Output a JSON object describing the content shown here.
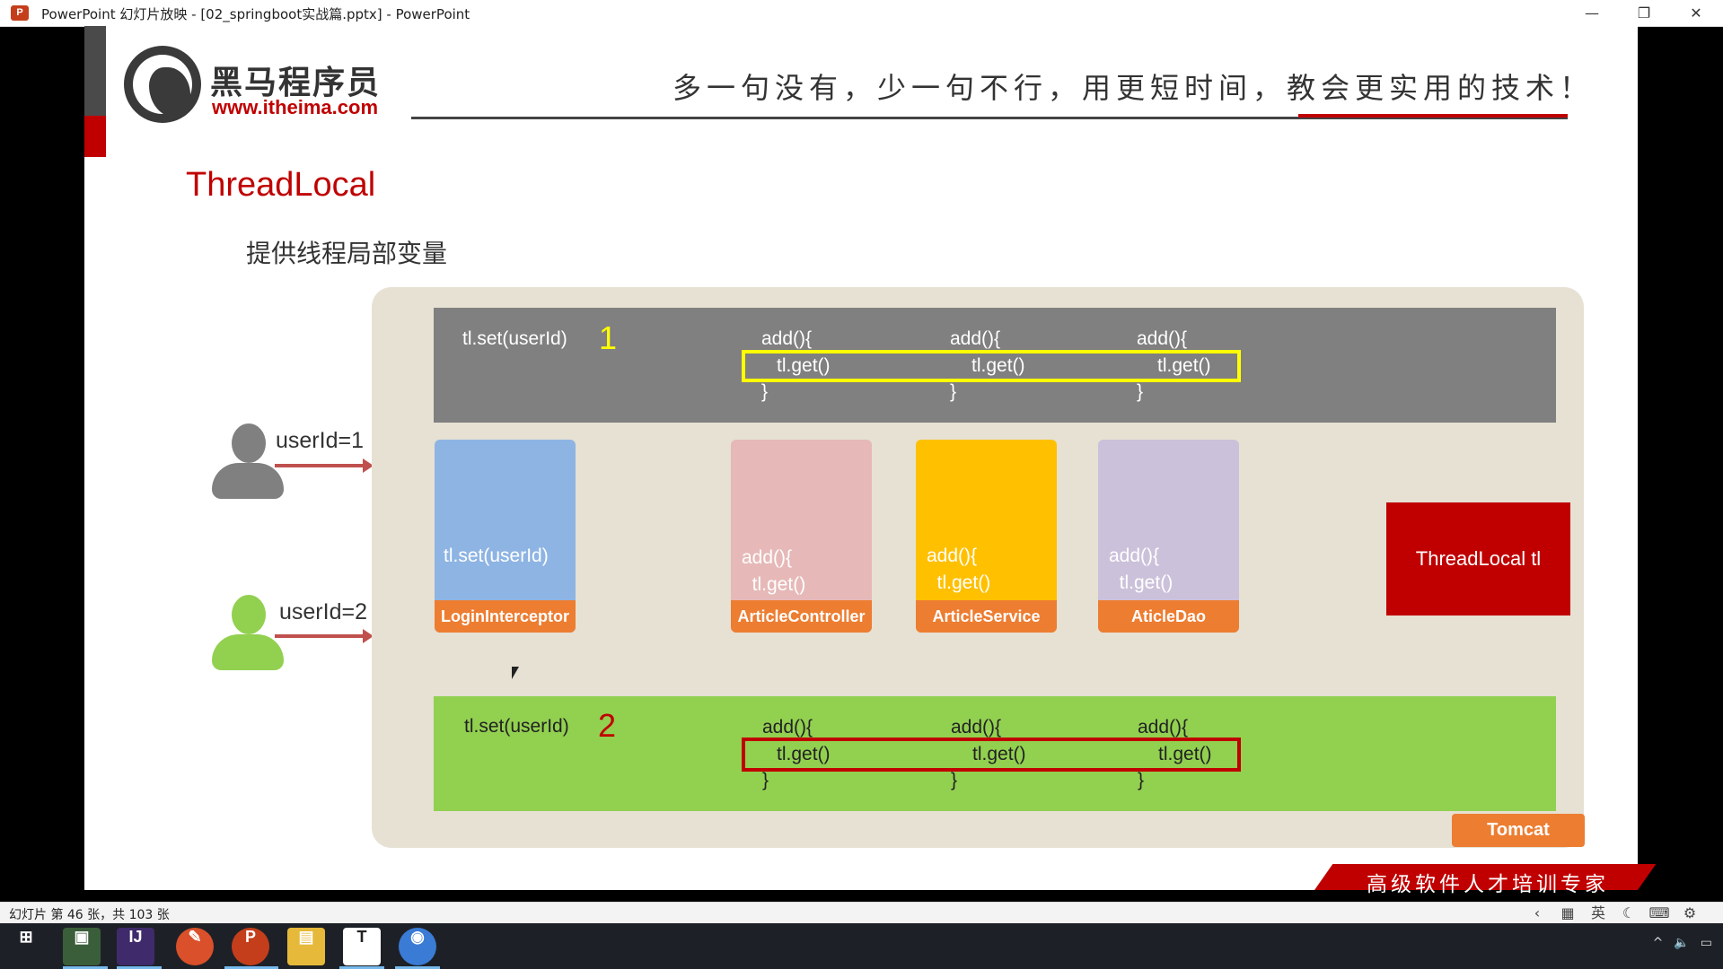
{
  "window": {
    "title": "PowerPoint 幻灯片放映 - [02_springboot实战篇.pptx] - PowerPoint",
    "app_icon": "P",
    "controls": {
      "minimize": "—",
      "restore": "❐",
      "close": "✕"
    }
  },
  "slide": {
    "logo": {
      "cn": "黑马程序员",
      "url": "www.itheima.com"
    },
    "slogan": "多一句没有，少一句不行，用更短时间，教会更实用的技术！",
    "title": "ThreadLocal",
    "subtitle": "提供线程局部变量",
    "users": [
      {
        "label": "userId=1",
        "color": "#808080"
      },
      {
        "label": "userId=2",
        "color": "#92d050"
      }
    ],
    "thread1": {
      "set": "tl.set(userId)",
      "num": "1",
      "calls": [
        {
          "open": "add(){",
          "get": "tl.get()",
          "close": "}"
        },
        {
          "open": "add(){",
          "get": "tl.get()",
          "close": "}"
        },
        {
          "open": "add(){",
          "get": "tl.get()",
          "close": "}"
        }
      ]
    },
    "thread2": {
      "set": "tl.set(userId)",
      "num": "2",
      "calls": [
        {
          "open": "add(){",
          "get": "tl.get()",
          "close": "}"
        },
        {
          "open": "add(){",
          "get": "tl.get()",
          "close": "}"
        },
        {
          "open": "add(){",
          "get": "tl.get()",
          "close": "}"
        }
      ]
    },
    "columns": [
      {
        "code": "tl.set(userId)",
        "label": "LoginInterceptor",
        "color": "#8eb4e3"
      },
      {
        "code": "add(){\n  tl.get()\n}",
        "label": "ArticleController",
        "color": "#e6b9b8"
      },
      {
        "code": "add(){\n  tl.get()\n}",
        "label": "ArticleService",
        "color": "#ffc000"
      },
      {
        "code": "add(){\n  tl.get()\n}",
        "label": "AticleDao",
        "color": "#ccc1da"
      }
    ],
    "threadlocal_box": "ThreadLocal   tl",
    "tomcat": "Tomcat",
    "brand": "高级软件人才培训专家"
  },
  "statusbar": {
    "slide_info": "幻灯片 第 46 张，共 103 张",
    "ime": "英"
  },
  "taskbar": {
    "items": [
      "start-icon",
      "bilibili-icon",
      "image-viewer-icon",
      "intellij-icon",
      "pen-tool-icon",
      "powerpoint-icon",
      "file-explorer-icon",
      "typora-icon",
      "chrome-icon"
    ]
  }
}
